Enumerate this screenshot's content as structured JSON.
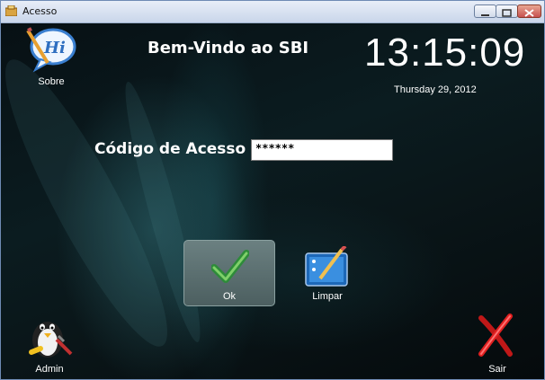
{
  "window": {
    "title": "Acesso"
  },
  "header": {
    "welcome": "Bem-Vindo ao SBI",
    "clock_time": "13:15:09",
    "date": "Thursday 29, 2012"
  },
  "form": {
    "label": "Código de Acesso",
    "value": "******"
  },
  "buttons": {
    "sobre": "Sobre",
    "ok": "Ok",
    "limpar": "Limpar",
    "admin": "Admin",
    "sair": "Sair"
  },
  "icons": {
    "sobre": "hi-bubble-icon",
    "ok": "checkmark-icon",
    "limpar": "clipboard-pen-icon",
    "admin": "penguin-tool-icon",
    "sair": "red-x-icon"
  },
  "colors": {
    "background": "#0a1619",
    "accent": "#2e8b3a",
    "close": "#d02020"
  }
}
